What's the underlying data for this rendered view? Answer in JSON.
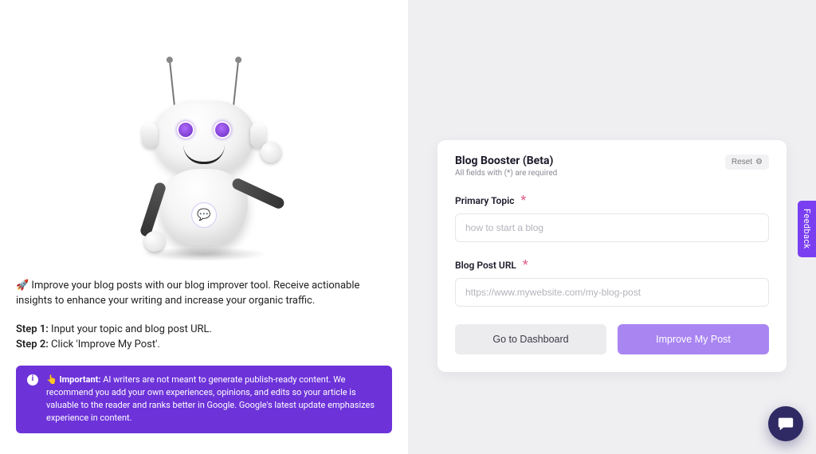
{
  "left": {
    "intro_emoji": "🚀",
    "intro_text": "Improve your blog posts with our blog improver tool. Receive actionable insights to enhance your writing and increase your organic traffic.",
    "step1_label": "Step 1:",
    "step1_text": " Input your topic and blog post URL.",
    "step2_label": "Step 2:",
    "step2_text": " Click 'Improve My Post'.",
    "notice_emoji": "👆",
    "notice_label": "Important:",
    "notice_text": " AI writers are not meant to generate publish-ready content. We recommend you add your own experiences, opinions, and edits so your article is valuable to the reader and ranks better in Google. Google's latest update emphasizes experience in content."
  },
  "form": {
    "title": "Blog Booster (Beta)",
    "subtitle": "All fields with (*) are required",
    "reset_label": "Reset",
    "primary_topic_label": "Primary Topic",
    "primary_topic_placeholder": "how to start a blog",
    "blog_url_label": "Blog Post URL",
    "blog_url_placeholder": "https://www.mywebsite.com/my-blog-post",
    "required_marker": "*",
    "dashboard_button": "Go to Dashboard",
    "improve_button": "Improve My Post"
  },
  "ui": {
    "feedback_tab": "Feedback"
  }
}
